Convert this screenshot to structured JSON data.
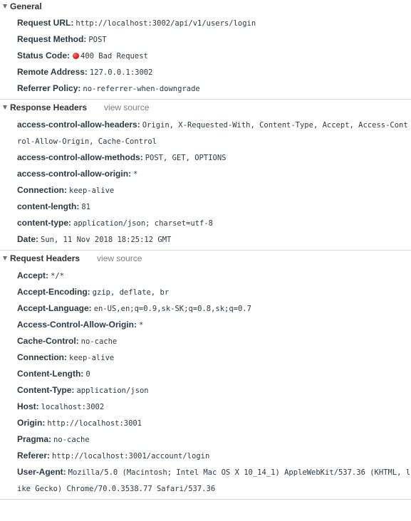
{
  "general": {
    "title": "General",
    "rows": [
      {
        "key": "Request URL:",
        "value": "http://localhost:3002/api/v1/users/login"
      },
      {
        "key": "Request Method:",
        "value": "POST"
      },
      {
        "key": "Status Code:",
        "value": "400 Bad Request",
        "status_color": "#e0201a"
      },
      {
        "key": "Remote Address:",
        "value": "127.0.0.1:3002"
      },
      {
        "key": "Referrer Policy:",
        "value": "no-referrer-when-downgrade"
      }
    ]
  },
  "response_headers": {
    "title": "Response Headers",
    "view_source": "view source",
    "rows": [
      {
        "key": "access-control-allow-headers:",
        "value": "Origin, X-Requested-With, Content-Type, Accept, Access-Control-Allow-Origin, Cache-Control"
      },
      {
        "key": "access-control-allow-methods:",
        "value": "POST, GET, OPTIONS"
      },
      {
        "key": "access-control-allow-origin:",
        "value": "*"
      },
      {
        "key": "Connection:",
        "value": "keep-alive"
      },
      {
        "key": "content-length:",
        "value": "81"
      },
      {
        "key": "content-type:",
        "value": "application/json; charset=utf-8"
      },
      {
        "key": "Date:",
        "value": "Sun, 11 Nov 2018 18:25:12 GMT"
      }
    ]
  },
  "request_headers": {
    "title": "Request Headers",
    "view_source": "view source",
    "rows": [
      {
        "key": "Accept:",
        "value": "*/*"
      },
      {
        "key": "Accept-Encoding:",
        "value": "gzip, deflate, br"
      },
      {
        "key": "Accept-Language:",
        "value": "en-US,en;q=0.9,sk-SK;q=0.8,sk;q=0.7"
      },
      {
        "key": "Access-Control-Allow-Origin:",
        "value": "*"
      },
      {
        "key": "Cache-Control:",
        "value": "no-cache"
      },
      {
        "key": "Connection:",
        "value": "keep-alive"
      },
      {
        "key": "Content-Length:",
        "value": "0"
      },
      {
        "key": "Content-Type:",
        "value": "application/json"
      },
      {
        "key": "Host:",
        "value": "localhost:3002"
      },
      {
        "key": "Origin:",
        "value": "http://localhost:3001"
      },
      {
        "key": "Pragma:",
        "value": "no-cache"
      },
      {
        "key": "Referer:",
        "value": "http://localhost:3001/account/login"
      },
      {
        "key": "User-Agent:",
        "value": "Mozilla/5.0 (Macintosh; Intel Mac OS X 10_14_1) AppleWebKit/537.36 (KHTML, like Gecko) Chrome/70.0.3538.77 Safari/537.36"
      }
    ]
  }
}
